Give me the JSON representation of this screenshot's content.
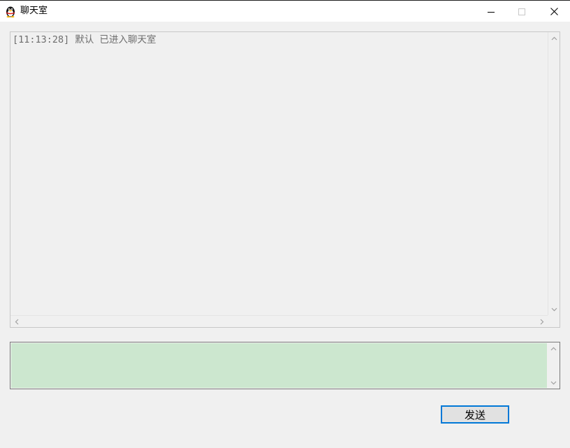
{
  "window": {
    "title": "聊天室",
    "icon": "qq-penguin-icon",
    "controls": [
      "minimize-icon",
      "maximize-icon",
      "close-icon"
    ]
  },
  "chat_log": {
    "lines": [
      "[11:13:28] 默认 已进入聊天室"
    ],
    "text_color": "#6d6d6d"
  },
  "message_input": {
    "value": "",
    "background": "#cce7cf"
  },
  "send_button": {
    "label": "发送",
    "border_color": "#0078d7"
  }
}
